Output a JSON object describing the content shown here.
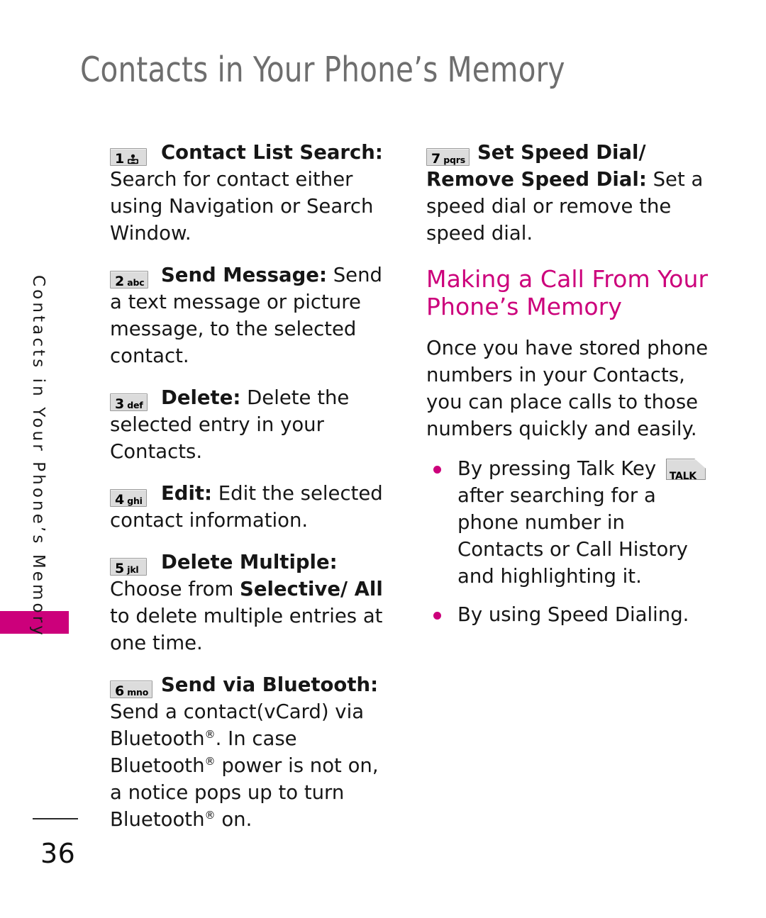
{
  "page": {
    "title": "Contacts in Your Phone’s Memory",
    "running_head": "Contacts in Your Phone’s Memory",
    "number": "36",
    "accent_color": "#cc007b",
    "title_color": "#6e6e6e"
  },
  "left_column": {
    "entries": [
      {
        "key": {
          "digit": "1",
          "letters": "",
          "icon": "voicemail-icon"
        },
        "label": "Contact List Search",
        "separator": ":",
        "body": " Search for contact either using Navigation or Search Window."
      },
      {
        "key": {
          "digit": "2",
          "letters": "abc",
          "icon": ""
        },
        "label": "Send Message",
        "separator": ":",
        "body": " Send a text message or picture message, to the selected contact."
      },
      {
        "key": {
          "digit": "3",
          "letters": "def",
          "icon": ""
        },
        "label": "Delete",
        "separator": ":",
        "body": " Delete the selected entry in your Contacts."
      },
      {
        "key": {
          "digit": "4",
          "letters": "ghi",
          "icon": ""
        },
        "label": "Edit",
        "separator": ":",
        "body": " Edit the selected contact information."
      },
      {
        "key": {
          "digit": "5",
          "letters": "jkl",
          "icon": ""
        },
        "label": "Delete Multiple",
        "separator": ":",
        "body_pre": " Choose from ",
        "body_bold": "Selective/ All",
        "body_post": " to delete multiple entries at one time."
      },
      {
        "key": {
          "digit": "6",
          "letters": "mno",
          "icon": ""
        },
        "label": "Send via Bluetooth",
        "separator": ":",
        "body_pre": " Send a contact(vCard) via Bluetooth",
        "body_post": ". In case Bluetooth® power is not on, a notice pops up to turn Bluetooth® on."
      }
    ]
  },
  "right_column": {
    "entries": [
      {
        "key": {
          "digit": "7",
          "letters": "pqrs",
          "icon": ""
        },
        "label": "Set Speed Dial/ Remove Speed Dial",
        "separator": ":",
        "body": " Set a speed dial or remove the speed dial."
      }
    ],
    "section_heading": "Making a Call From Your Phone’s Memory",
    "intro_paragraph": "Once you have stored phone numbers in your Contacts, you can place calls to those numbers quickly and easily.",
    "bullets": [
      {
        "text_pre": "By pressing Talk Key ",
        "key_label": "TALK",
        "text_post": " after searching for a phone number in Contacts or Call History and highlighting it."
      },
      {
        "text_pre": "By using Speed Dialing.",
        "key_label": "",
        "text_post": ""
      }
    ]
  }
}
